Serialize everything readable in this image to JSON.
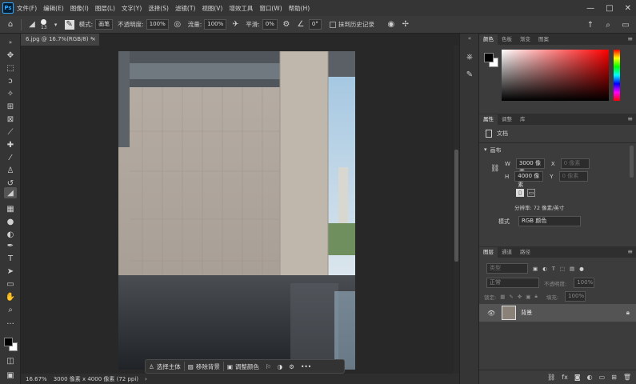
{
  "app": {
    "logo": "Ps"
  },
  "menubar": {
    "items": [
      "文件(F)",
      "编辑(E)",
      "图像(I)",
      "图层(L)",
      "文字(Y)",
      "选择(S)",
      "滤镜(T)",
      "视图(V)",
      "增效工具",
      "窗口(W)",
      "帮助(H)"
    ],
    "window_controls": [
      "—",
      "□",
      "✕"
    ]
  },
  "options_bar": {
    "brush_size": "13",
    "mode_label": "模式:",
    "mode_value": "画笔",
    "opacity_label": "不透明度:",
    "opacity_value": "100%",
    "flow_label": "流量:",
    "flow_value": "100%",
    "smoothing_label": "平滑:",
    "smoothing_value": "0%",
    "angle_value": "0°",
    "history_label": "抹到历史记录"
  },
  "document": {
    "tab_title": "6.jpg @ 16.7%(RGB/8) *",
    "close": "×",
    "zoom": "16.67%",
    "status": "3000 像素 x 4000 像素 (72 ppi)"
  },
  "taskbar": {
    "select_subject": "选择主体",
    "remove_background": "移除背景",
    "adjust_color": "调整颜色",
    "more": "•••"
  },
  "color_panel": {
    "tabs": [
      "颜色",
      "色板",
      "渐变",
      "图案"
    ]
  },
  "properties_panel": {
    "tabs": [
      "属性",
      "调整",
      "库"
    ],
    "doc_label": "文档",
    "section_canvas": "画布",
    "w_label": "W",
    "w_value": "3000 像素",
    "h_label": "H",
    "h_value": "4000 像素",
    "x_label": "X",
    "x_placeholder": "0 像素",
    "y_label": "Y",
    "y_placeholder": "0 像素",
    "resolution": "分辨率: 72 像素/英寸",
    "mode_label": "模式",
    "mode_value": "RGB 颜色"
  },
  "layers_panel": {
    "tabs": [
      "图层",
      "通道",
      "路径"
    ],
    "kind_placeholder": "类型",
    "blend_mode": "正常",
    "opacity_label": "不透明度:",
    "opacity_value": "100%",
    "lock_label": "锁定:",
    "fill_label": "填充:",
    "fill_value": "100%",
    "layers": [
      {
        "name": "背景"
      }
    ],
    "footer_icons": [
      "link-icon",
      "fx-icon",
      "mask-icon",
      "adjustment-icon",
      "group-icon",
      "new-layer-icon",
      "delete-icon"
    ]
  },
  "colors": {
    "accent": "#31a8ff",
    "app_bg": "#282828",
    "panel_bg": "#3c3c3c",
    "foreground": "#000000",
    "background": "#ffffff",
    "picker_hue": "#ff0000"
  }
}
